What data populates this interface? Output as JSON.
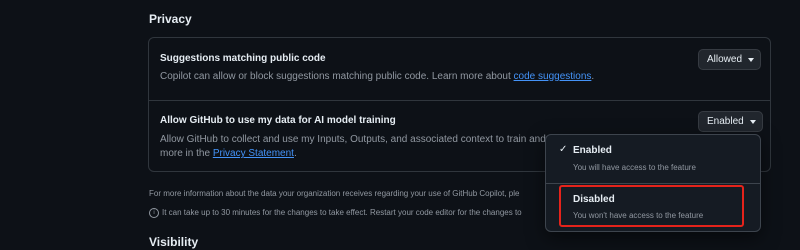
{
  "privacy": {
    "section_title": "Privacy",
    "suggestions": {
      "title": "Suggestions matching public code",
      "desc_prefix": "Copilot can allow or block suggestions matching public code. Learn more about ",
      "desc_link": "code suggestions",
      "desc_suffix": ".",
      "select_value": "Allowed"
    },
    "training": {
      "title": "Allow GitHub to use my data for AI model training",
      "desc_line1": "Allow GitHub to collect and use my Inputs, Outputs, and associated context to train and in",
      "desc_line2_prefix": "more in the ",
      "desc_link": "Privacy Statement",
      "desc_line2_suffix": ".",
      "select_value": "Enabled"
    },
    "info_line1": "For more information about the data your organization receives regarding your use of GitHub Copilot, ple",
    "info_line2": "It can take up to 30 minutes for the changes to take effect. Restart your code editor for the changes to"
  },
  "dropdown": {
    "options": [
      {
        "label": "Enabled",
        "desc": "You will have access to the feature",
        "checked": true
      },
      {
        "label": "Disabled",
        "desc": "You won't have access to the feature",
        "checked": false
      }
    ],
    "check_glyph": "✓"
  },
  "visibility": {
    "section_title": "Visibility"
  },
  "icons": {
    "info": "info-icon",
    "check": "check-icon",
    "caret": "chevron-down-icon"
  },
  "colors": {
    "accent_link": "#4493f8",
    "highlight_border": "#e5231b",
    "background": "#0d1117"
  }
}
